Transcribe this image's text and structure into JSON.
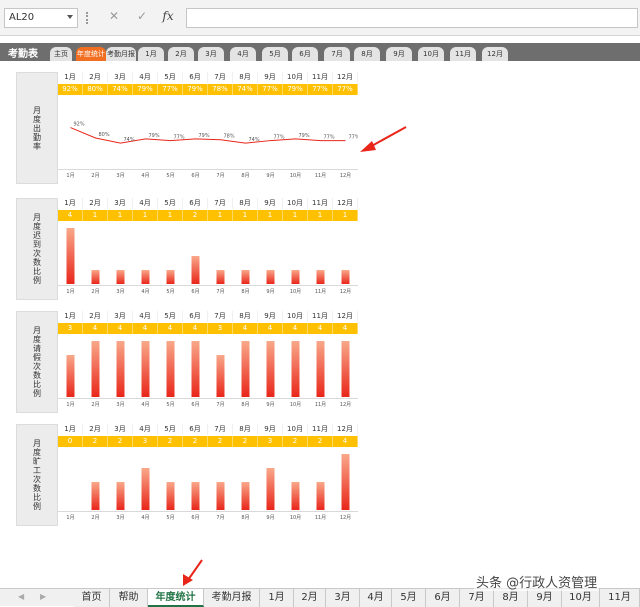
{
  "formula_bar": {
    "name_box": "AL20",
    "cancel_icon": "✕",
    "confirm_icon": "✓",
    "fx_label": "fx",
    "formula": ""
  },
  "inner_tabs": {
    "title": "考勤表",
    "items": [
      "主页",
      "年度统计",
      "考勤月报",
      "1月",
      "2月",
      "3月",
      "4月",
      "5月",
      "6月",
      "7月",
      "8月",
      "9月",
      "10月",
      "11月",
      "12月"
    ],
    "active": "年度统计"
  },
  "months": [
    "1月",
    "2月",
    "3月",
    "4月",
    "5月",
    "6月",
    "7月",
    "8月",
    "9月",
    "10月",
    "11月",
    "12月"
  ],
  "colors": {
    "accent": "#ffc000",
    "bar_top": "#f9a88a",
    "bar_bottom": "#e8261a",
    "line": "#e8261a",
    "active_tab": "#f26f21"
  },
  "sections": [
    {
      "label": "月度出勤率",
      "values": [
        "92%",
        "80%",
        "74%",
        "79%",
        "77%",
        "79%",
        "78%",
        "74%",
        "77%",
        "79%",
        "77%",
        "77%"
      ]
    },
    {
      "label": "月度迟到次数比例",
      "values": [
        "4",
        "1",
        "1",
        "1",
        "1",
        "2",
        "1",
        "1",
        "1",
        "1",
        "1",
        "1"
      ]
    },
    {
      "label": "月度请假次数比例",
      "values": [
        "3",
        "4",
        "4",
        "4",
        "4",
        "4",
        "3",
        "4",
        "4",
        "4",
        "4",
        "4"
      ]
    },
    {
      "label": "月度旷工次数比例",
      "values": [
        "0",
        "2",
        "2",
        "3",
        "2",
        "2",
        "2",
        "2",
        "3",
        "2",
        "2",
        "4"
      ]
    }
  ],
  "chart_data": [
    {
      "type": "line",
      "categories": [
        "1月",
        "2月",
        "3月",
        "4月",
        "5月",
        "6月",
        "7月",
        "8月",
        "9月",
        "10月",
        "11月",
        "12月"
      ],
      "values": [
        92,
        80,
        74,
        79,
        77,
        79,
        78,
        74,
        77,
        79,
        77,
        77
      ],
      "ylim": [
        0,
        100
      ]
    },
    {
      "type": "bar",
      "categories": [
        "1月",
        "2月",
        "3月",
        "4月",
        "5月",
        "6月",
        "7月",
        "8月",
        "9月",
        "10月",
        "11月",
        "12月"
      ],
      "values": [
        4,
        1,
        1,
        1,
        1,
        2,
        1,
        1,
        1,
        1,
        1,
        1
      ],
      "ylim": [
        0,
        4
      ]
    },
    {
      "type": "bar",
      "categories": [
        "1月",
        "2月",
        "3月",
        "4月",
        "5月",
        "6月",
        "7月",
        "8月",
        "9月",
        "10月",
        "11月",
        "12月"
      ],
      "values": [
        3,
        4,
        4,
        4,
        4,
        4,
        3,
        4,
        4,
        4,
        4,
        4
      ],
      "ylim": [
        0,
        4
      ]
    },
    {
      "type": "bar",
      "categories": [
        "1月",
        "2月",
        "3月",
        "4月",
        "5月",
        "6月",
        "7月",
        "8月",
        "9月",
        "10月",
        "11月",
        "12月"
      ],
      "values": [
        0,
        2,
        2,
        3,
        2,
        2,
        2,
        2,
        3,
        2,
        2,
        4
      ],
      "ylim": [
        0,
        4
      ]
    }
  ],
  "sheet_tabs": {
    "items": [
      "首页",
      "帮助",
      "年度统计",
      "考勤月报",
      "1月",
      "2月",
      "3月",
      "4月",
      "5月",
      "6月",
      "7月",
      "8月",
      "9月",
      "10月",
      "11月"
    ],
    "active": "年度统计"
  },
  "watermark": "头条 @行政人资管理"
}
